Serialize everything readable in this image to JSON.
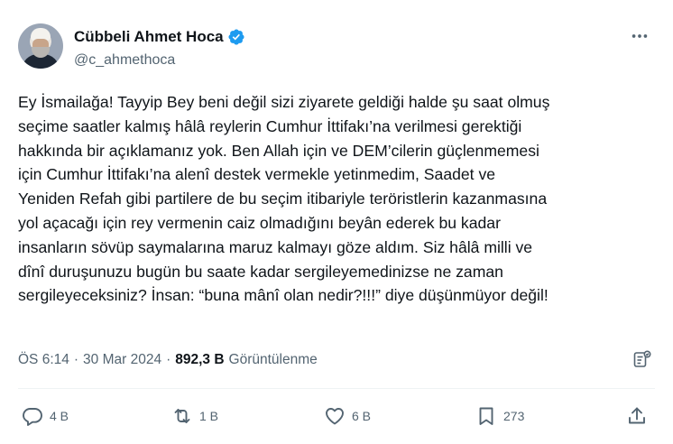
{
  "author": {
    "display_name": "Cübbeli Ahmet Hoca",
    "handle": "@c_ahmethoca",
    "verified_color": "#1d9bf0"
  },
  "tweet": {
    "lines": [
      "Ey İsmailağa! Tayyip Bey beni değil sizi ziyarete geldiği halde şu saat olmuş",
      "seçime saatler kalmış hâlâ reylerin Cumhur İttifakı’na verilmesi gerektiği",
      "hakkında bir açıklamanız yok. Ben Allah için ve DEM’cilerin güçlenmemesi",
      "için Cumhur İttifakı’na alenî destek vermekle yetinmedim, Saadet ve",
      "Yeniden Refah gibi partilere de bu seçim itibariyle teröristlerin kazanmasına",
      "yol açacağı için rey vermenin caiz olmadığını beyân ederek bu kadar",
      "insanların sövüp saymalarına maruz kalmayı göze aldım. Siz hâlâ milli ve",
      "dînî duruşunuzu bugün bu saate kadar sergileyemedinizse ne zaman",
      "sergileyeceksiniz? İnsan: “buna mânî olan nedir?!!!” diye düşünmüyor değil!"
    ]
  },
  "meta": {
    "time": "ÖS 6:14",
    "separator": "·",
    "date": "30 Mar 2024",
    "views_count": "892,3 B",
    "views_label": "Görüntülenme"
  },
  "actions": {
    "reply_count": "4 B",
    "repost_count": "1 B",
    "like_count": "6 B",
    "bookmark_count": "273"
  },
  "icons": {
    "more": "more-horizontal-icon",
    "verified": "verified-badge-icon",
    "analytics": "grok-analyze-icon",
    "reply": "reply-icon",
    "repost": "repost-icon",
    "like": "heart-icon",
    "bookmark": "bookmark-icon",
    "share": "share-icon"
  },
  "colors": {
    "text": "#0f1419",
    "secondary": "#536471",
    "accent": "#1d9bf0"
  }
}
